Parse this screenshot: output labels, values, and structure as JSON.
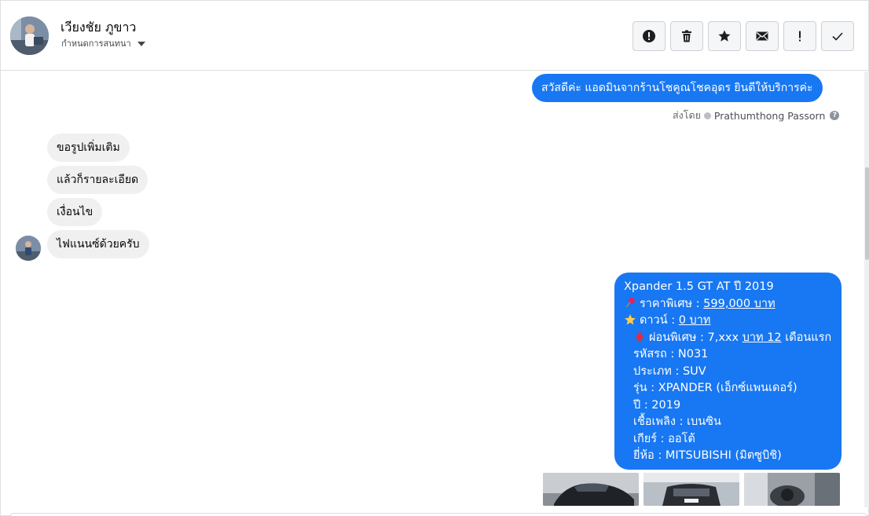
{
  "header": {
    "contact_name": "เวียงชัย ภูขาว",
    "conversation_settings_label": "กำหนดการสนทนา",
    "actions": [
      {
        "name": "report-spam-button",
        "icon": "alert-circle-icon"
      },
      {
        "name": "delete-button",
        "icon": "trash-icon"
      },
      {
        "name": "star-button",
        "icon": "star-icon"
      },
      {
        "name": "mark-unread-button",
        "icon": "envelope-icon"
      },
      {
        "name": "follow-up-button",
        "icon": "exclamation-icon"
      },
      {
        "name": "mark-done-button",
        "icon": "check-icon"
      }
    ]
  },
  "messages": {
    "greeting": "สวัสดีค่ะ แอดมินจากร้านโชคูณโชคอุดร ยินดีให้บริการค่ะ",
    "sent_by_prefix": "ส่งโดย",
    "sent_by_name": "Prathumthong Passorn",
    "incoming": [
      "ขอรูปเพิ่มเติม",
      "แล้วก็รายละเอียด",
      "เงื่อนไข",
      "ไฟแนนซ์ด้วยครับ"
    ],
    "listing": {
      "title": "Xpander 1.5 GT AT ปี 2019",
      "price_label": "ราคาพิเศษ : ",
      "price_value": "599,000 บาท",
      "down_label": "ดาวน์ : ",
      "down_value": "0 บาท",
      "installment_label": "ผ่อนพิเศษ : 7,xxx ",
      "installment_link": "บาท 12",
      "installment_suffix": " เดือนแรก",
      "code": "รหัสรถ : N031",
      "type": "ประเภท : SUV",
      "model": "รุ่น : XPANDER (เอ็กซ์แพนเดอร์)",
      "year": "ปี : 2019",
      "fuel": "เชื้อเพลิง : เบนซิน",
      "gear": "เกียร์ : ออโต้",
      "brand": "ยี่ห้อ : MITSUBISHI (มิตซูบิชิ)"
    }
  },
  "colors": {
    "outgoing_bubble": "#1877f2",
    "incoming_bubble": "#f0f0f0",
    "border": "#dddfe2"
  }
}
